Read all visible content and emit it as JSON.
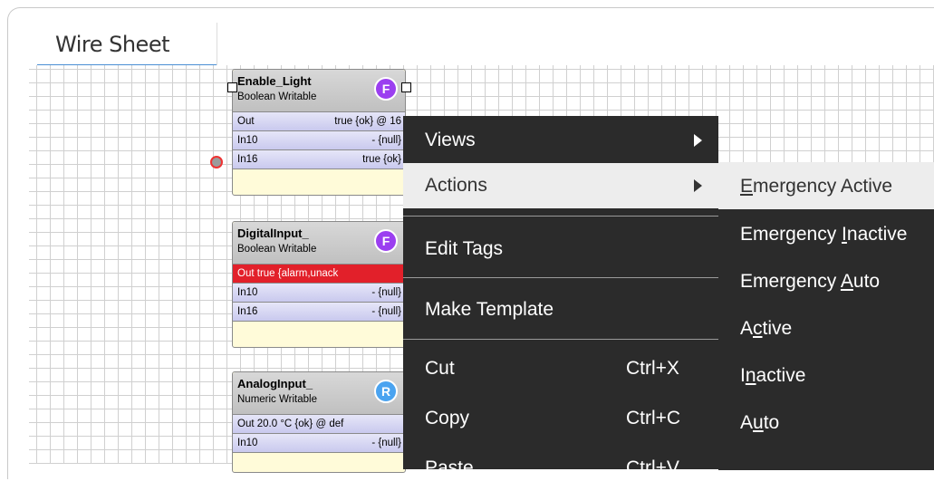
{
  "tab": {
    "label": "Wire Sheet"
  },
  "components": [
    {
      "title": "Enable_Light",
      "type": "Boolean Writable",
      "badge": "F",
      "badge_color": "#9b3ff0",
      "slots": [
        {
          "name": "Out",
          "value": "true {ok} @ 16",
          "alarm": false
        },
        {
          "name": "In10",
          "value": "- {null}",
          "alarm": false
        },
        {
          "name": "In16",
          "value": "true {ok}",
          "alarm": false
        }
      ]
    },
    {
      "title": "DigitalInput_",
      "type": "Boolean Writable",
      "badge": "F",
      "badge_color": "#9b3ff0",
      "slots": [
        {
          "name": "Out",
          "value": "true {alarm,unack",
          "alarm": true
        },
        {
          "name": "In10",
          "value": "- {null}",
          "alarm": false
        },
        {
          "name": "In16",
          "value": "- {null}",
          "alarm": false
        }
      ]
    },
    {
      "title": "AnalogInput_",
      "type": "Numeric Writable",
      "badge": "R",
      "badge_color": "#4aa3f0",
      "slots": [
        {
          "name": "Out",
          "value": "20.0 °C {ok} @ def",
          "alarm": false
        },
        {
          "name": "In10",
          "value": "- {null}",
          "alarm": false
        }
      ]
    }
  ],
  "context_menu": {
    "items": [
      {
        "label": "Views",
        "submenu": true
      },
      {
        "label": "Actions",
        "submenu": true,
        "highlighted": true
      },
      {
        "label": "Edit Tags"
      },
      {
        "label": "Make Template"
      },
      {
        "label": "Cut",
        "shortcut": "Ctrl+X"
      },
      {
        "label": "Copy",
        "shortcut": "Ctrl+C"
      },
      {
        "label": "Paste",
        "shortcut": "Ctrl+V"
      }
    ]
  },
  "actions_submenu": {
    "items": [
      {
        "pre": "",
        "u": "E",
        "post": "mergency Active"
      },
      {
        "pre": "Emergency ",
        "u": "I",
        "post": "nactive"
      },
      {
        "pre": "Emergency ",
        "u": "A",
        "post": "uto"
      },
      {
        "pre": "A",
        "u": "c",
        "post": "tive"
      },
      {
        "pre": "I",
        "u": "n",
        "post": "active"
      },
      {
        "pre": "A",
        "u": "u",
        "post": "to"
      }
    ]
  }
}
